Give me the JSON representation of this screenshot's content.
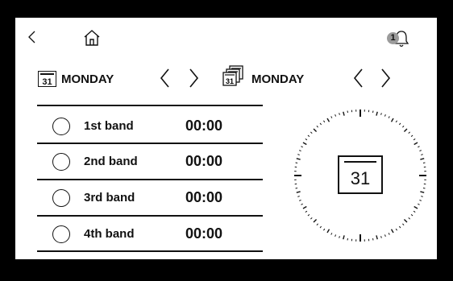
{
  "header": {
    "notification_count": "1"
  },
  "left_panel": {
    "calendar_date": "31",
    "day": "MONDAY"
  },
  "right_panel": {
    "calendar_date": "31",
    "day": "MONDAY"
  },
  "bands": [
    {
      "label": "1st band",
      "time": "00:00"
    },
    {
      "label": "2nd band",
      "time": "00:00"
    },
    {
      "label": "3rd band",
      "time": "00:00"
    },
    {
      "label": "4th band",
      "time": "00:00"
    }
  ],
  "clock": {
    "calendar_date": "31"
  }
}
